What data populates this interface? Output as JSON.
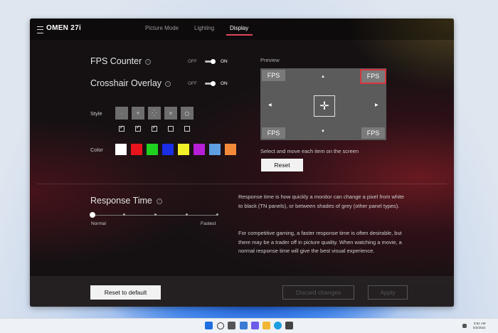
{
  "app": {
    "title": "OMEN 27i",
    "tabs": [
      {
        "label": "Picture Mode",
        "active": false
      },
      {
        "label": "Lighting",
        "active": false
      },
      {
        "label": "Display",
        "active": true
      }
    ],
    "accent_color": "#e0455a"
  },
  "settings": {
    "fps_counter": {
      "label": "FPS Counter",
      "off": "OFF",
      "on": "ON",
      "state": "on"
    },
    "crosshair_overlay": {
      "label": "Crosshair Overlay",
      "off": "OFF",
      "on": "ON",
      "state": "on"
    },
    "style": {
      "label": "Style",
      "options": [
        {
          "icon": "dot-crosshair-icon",
          "glyph": "·",
          "checked": true
        },
        {
          "icon": "plus-crosshair-icon",
          "glyph": "+",
          "checked": true
        },
        {
          "icon": "dotted-crosshair-icon",
          "glyph": "⁛",
          "checked": true
        },
        {
          "icon": "x-crosshair-icon",
          "glyph": "×",
          "checked": false
        },
        {
          "icon": "circle-crosshair-icon",
          "glyph": "○",
          "checked": false
        }
      ]
    },
    "color": {
      "label": "Color",
      "swatches": [
        "#ffffff",
        "#e8141c",
        "#1fd21f",
        "#1a2ee6",
        "#f2f22a",
        "#b61fd6",
        "#5f9ee0",
        "#f28a3a"
      ]
    }
  },
  "preview": {
    "label": "Preview",
    "fps_items": [
      "FPS",
      "FPS",
      "FPS",
      "FPS"
    ],
    "selected_index": 1,
    "hint": "Select and move each item on the screen",
    "reset_label": "Reset"
  },
  "response_time": {
    "label": "Response Time",
    "min_label": "Normal",
    "max_label": "Fastest",
    "level": 0,
    "steps": 5,
    "description_1": "Response time is how quickly a monitor can change a pixel from white to black (TN panels), or between shades of grey (other panel types).",
    "description_2": "For competitive gaming, a faster response time is often desirable, but there may be a trader off in picture quality. When watching a movie, a normal response time will give the best visual experience."
  },
  "footer": {
    "reset_default_label": "Reset to default",
    "discard_label": "Discard changes",
    "apply_label": "Apply"
  },
  "taskbar": {
    "time": "8:51 AM",
    "date": "5/2/2022"
  }
}
